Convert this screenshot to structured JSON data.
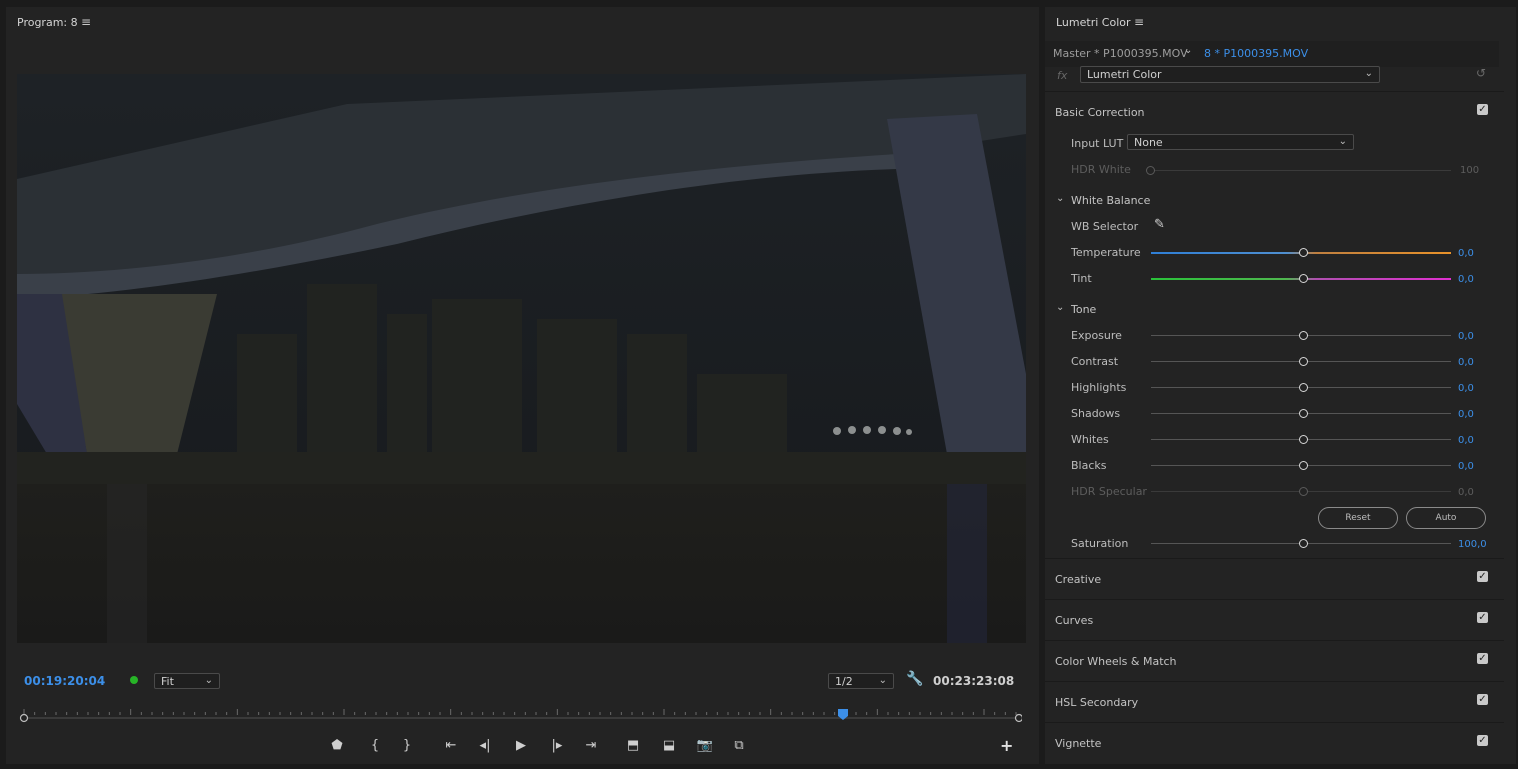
{
  "program": {
    "title": "Program: 8",
    "current_timecode": "00:19:20:04",
    "zoom": "Fit",
    "resolution": "1/2",
    "duration_timecode": "00:23:23:08",
    "playhead_position": 0.826
  },
  "lumetri": {
    "title": "Lumetri Color",
    "clip_master": "Master * P1000395.MOV",
    "clip_instance": "8 * P1000395.MOV",
    "effect_name": "Lumetri Color",
    "fx_label": "fx",
    "basic_correction": {
      "title": "Basic Correction",
      "input_lut_label": "Input LUT",
      "input_lut_value": "None",
      "hdr_white_label": "HDR White",
      "hdr_white_value": "100",
      "white_balance_title": "White Balance",
      "wb_selector_label": "WB Selector",
      "temperature": {
        "label": "Temperature",
        "value": "0,0"
      },
      "tint": {
        "label": "Tint",
        "value": "0,0"
      },
      "tone_title": "Tone",
      "exposure": {
        "label": "Exposure",
        "value": "0,0"
      },
      "contrast": {
        "label": "Contrast",
        "value": "0,0"
      },
      "highlights": {
        "label": "Highlights",
        "value": "0,0"
      },
      "shadows": {
        "label": "Shadows",
        "value": "0,0"
      },
      "whites": {
        "label": "Whites",
        "value": "0,0"
      },
      "blacks": {
        "label": "Blacks",
        "value": "0,0"
      },
      "hdr_specular": {
        "label": "HDR Specular",
        "value": "0,0"
      },
      "reset_label": "Reset",
      "auto_label": "Auto",
      "saturation": {
        "label": "Saturation",
        "value": "100,0"
      }
    },
    "sections": {
      "creative": "Creative",
      "curves": "Curves",
      "color_wheels": "Color Wheels & Match",
      "hsl_secondary": "HSL Secondary",
      "vignette": "Vignette"
    }
  },
  "colors": {
    "accent": "#3c8fe8",
    "status_green": "#27b427"
  }
}
